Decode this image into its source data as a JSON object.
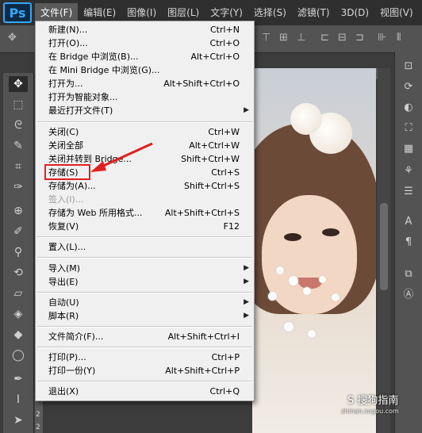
{
  "app": {
    "logo": "Ps"
  },
  "menubar": {
    "items": [
      "文件(F)",
      "编辑(E)",
      "图像(I)",
      "图层(L)",
      "文字(Y)",
      "选择(S)",
      "滤镜(T)",
      "3D(D)",
      "视图(V)"
    ]
  },
  "ruler": {
    "left_numbers": [
      "2",
      "2"
    ]
  },
  "file_menu": {
    "items": [
      {
        "label": "新建(N)...",
        "shortcut": "Ctrl+N"
      },
      {
        "label": "打开(O)...",
        "shortcut": "Ctrl+O"
      },
      {
        "label": "在 Bridge 中浏览(B)...",
        "shortcut": "Alt+Ctrl+O"
      },
      {
        "label": "在 Mini Bridge 中浏览(G)...",
        "shortcut": ""
      },
      {
        "label": "打开为...",
        "shortcut": "Alt+Shift+Ctrl+O"
      },
      {
        "label": "打开为智能对象...",
        "shortcut": ""
      },
      {
        "label": "最近打开文件(T)",
        "shortcut": ""
      },
      {
        "label": "关闭(C)",
        "shortcut": "Ctrl+W"
      },
      {
        "label": "关闭全部",
        "shortcut": "Alt+Ctrl+W"
      },
      {
        "label": "关闭并转到 Bridge...",
        "shortcut": "Shift+Ctrl+W"
      },
      {
        "label": "存储(S)",
        "shortcut": "Ctrl+S"
      },
      {
        "label": "存储为(A)...",
        "shortcut": "Shift+Ctrl+S"
      },
      {
        "label": "签入(I)...",
        "shortcut": ""
      },
      {
        "label": "存储为 Web 所用格式...",
        "shortcut": "Alt+Shift+Ctrl+S"
      },
      {
        "label": "恢复(V)",
        "shortcut": "F12"
      },
      {
        "label": "置入(L)...",
        "shortcut": ""
      },
      {
        "label": "导入(M)",
        "shortcut": ""
      },
      {
        "label": "导出(E)",
        "shortcut": ""
      },
      {
        "label": "自动(U)",
        "shortcut": ""
      },
      {
        "label": "脚本(R)",
        "shortcut": ""
      },
      {
        "label": "文件简介(F)...",
        "shortcut": "Alt+Shift+Ctrl+I"
      },
      {
        "label": "打印(P)...",
        "shortcut": "Ctrl+P"
      },
      {
        "label": "打印一份(Y)",
        "shortcut": "Alt+Shift+Ctrl+P"
      },
      {
        "label": "退出(X)",
        "shortcut": "Ctrl+Q"
      }
    ]
  },
  "watermark": {
    "text": "S 搜狗指南",
    "url_text": "zhinan.sogou.com"
  },
  "colors": {
    "highlight": "#e02020",
    "menubar_bg": "#2f2f2f",
    "menu_bg": "#f0f0f0",
    "ps_blue": "#31a8ff"
  },
  "icons": [
    "move-icon",
    "marquee-icon",
    "lasso-icon",
    "quick-select-icon",
    "crop-icon",
    "eyedropper-icon",
    "healing-icon",
    "brush-icon",
    "stamp-icon",
    "history-brush-icon",
    "eraser-icon",
    "bucket-icon",
    "blur-icon",
    "dodge-icon",
    "pen-icon",
    "type-icon",
    "path-select-icon"
  ]
}
